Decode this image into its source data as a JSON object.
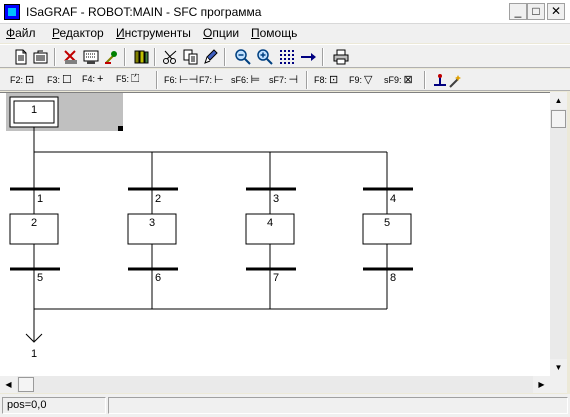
{
  "window": {
    "title": "ISaGRAF - ROBOT:MAIN - SFC программа",
    "controls": [
      "_",
      "□",
      "✕"
    ]
  },
  "menu": [
    {
      "label": "Файл",
      "accel": "Ф",
      "rest": "айл"
    },
    {
      "label": "Редактор",
      "accel": "Р",
      "rest": "едактор"
    },
    {
      "label": "Инструменты",
      "accel": "И",
      "rest": "нструменты"
    },
    {
      "label": "Опции",
      "accel": "О",
      "rest": "пции"
    },
    {
      "label": "Помощь",
      "accel": "П",
      "rest": "омощь"
    }
  ],
  "toolbar_icons": [
    "new-file-icon",
    "open-file-icon",
    "cut-variables-icon",
    "dictionary-icon",
    "tool-icon",
    "library-icon",
    "scissors-icon",
    "copy-icon",
    "paste-brush-icon",
    "zoom-out-icon",
    "zoom-in-icon",
    "grid-icon",
    "arrow-right-icon",
    "print-icon"
  ],
  "fkeys": [
    {
      "key": "F2:",
      "glyph": "⊡"
    },
    {
      "key": "F3:",
      "glyph": "☐"
    },
    {
      "key": "F4:",
      "glyph": "+"
    },
    {
      "key": "F5:",
      "glyph": "⏍"
    },
    {
      "key": "F6:",
      "glyph": "⊢⊣"
    },
    {
      "key": "F7:",
      "glyph": "⊢"
    },
    {
      "key": "sF6:",
      "glyph": "⊨"
    },
    {
      "key": "sF7:",
      "glyph": "⊣"
    },
    {
      "key": "F8:",
      "glyph": "⊡"
    },
    {
      "key": "F9:",
      "glyph": "▽"
    },
    {
      "key": "sF9:",
      "glyph": "⊠"
    }
  ],
  "sfc": {
    "initial_step": "1",
    "steps": [
      "2",
      "3",
      "4",
      "5"
    ],
    "transitions_top": [
      "1",
      "2",
      "3",
      "4"
    ],
    "transitions_bottom": [
      "5",
      "6",
      "7",
      "8"
    ],
    "jump_target": "1"
  },
  "status": {
    "position": "pos=0,0"
  }
}
